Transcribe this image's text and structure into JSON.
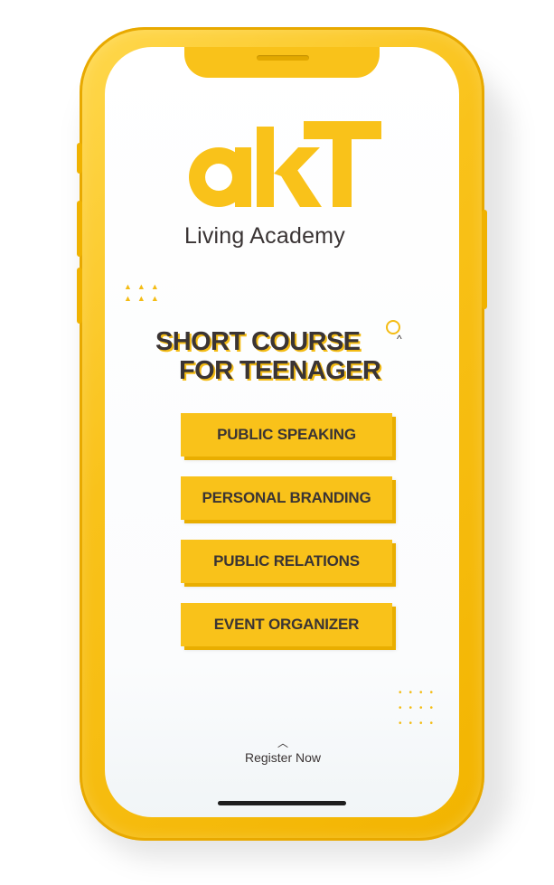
{
  "brand": {
    "logo_text": "akT",
    "subtitle": "Living Academy",
    "accent_color": "#f9c21a",
    "text_color": "#3a3434"
  },
  "header": {
    "title_line1": "SHORT COURSE",
    "title_line2": "FOR TEENAGER"
  },
  "courses": [
    {
      "label": "PUBLIC SPEAKING"
    },
    {
      "label": "PERSONAL BRANDING"
    },
    {
      "label": "PUBLIC RELATIONS"
    },
    {
      "label": "EVENT ORGANIZER"
    }
  ],
  "footer": {
    "register_label": "Register Now",
    "register_icon": "chevron-up-icon"
  }
}
